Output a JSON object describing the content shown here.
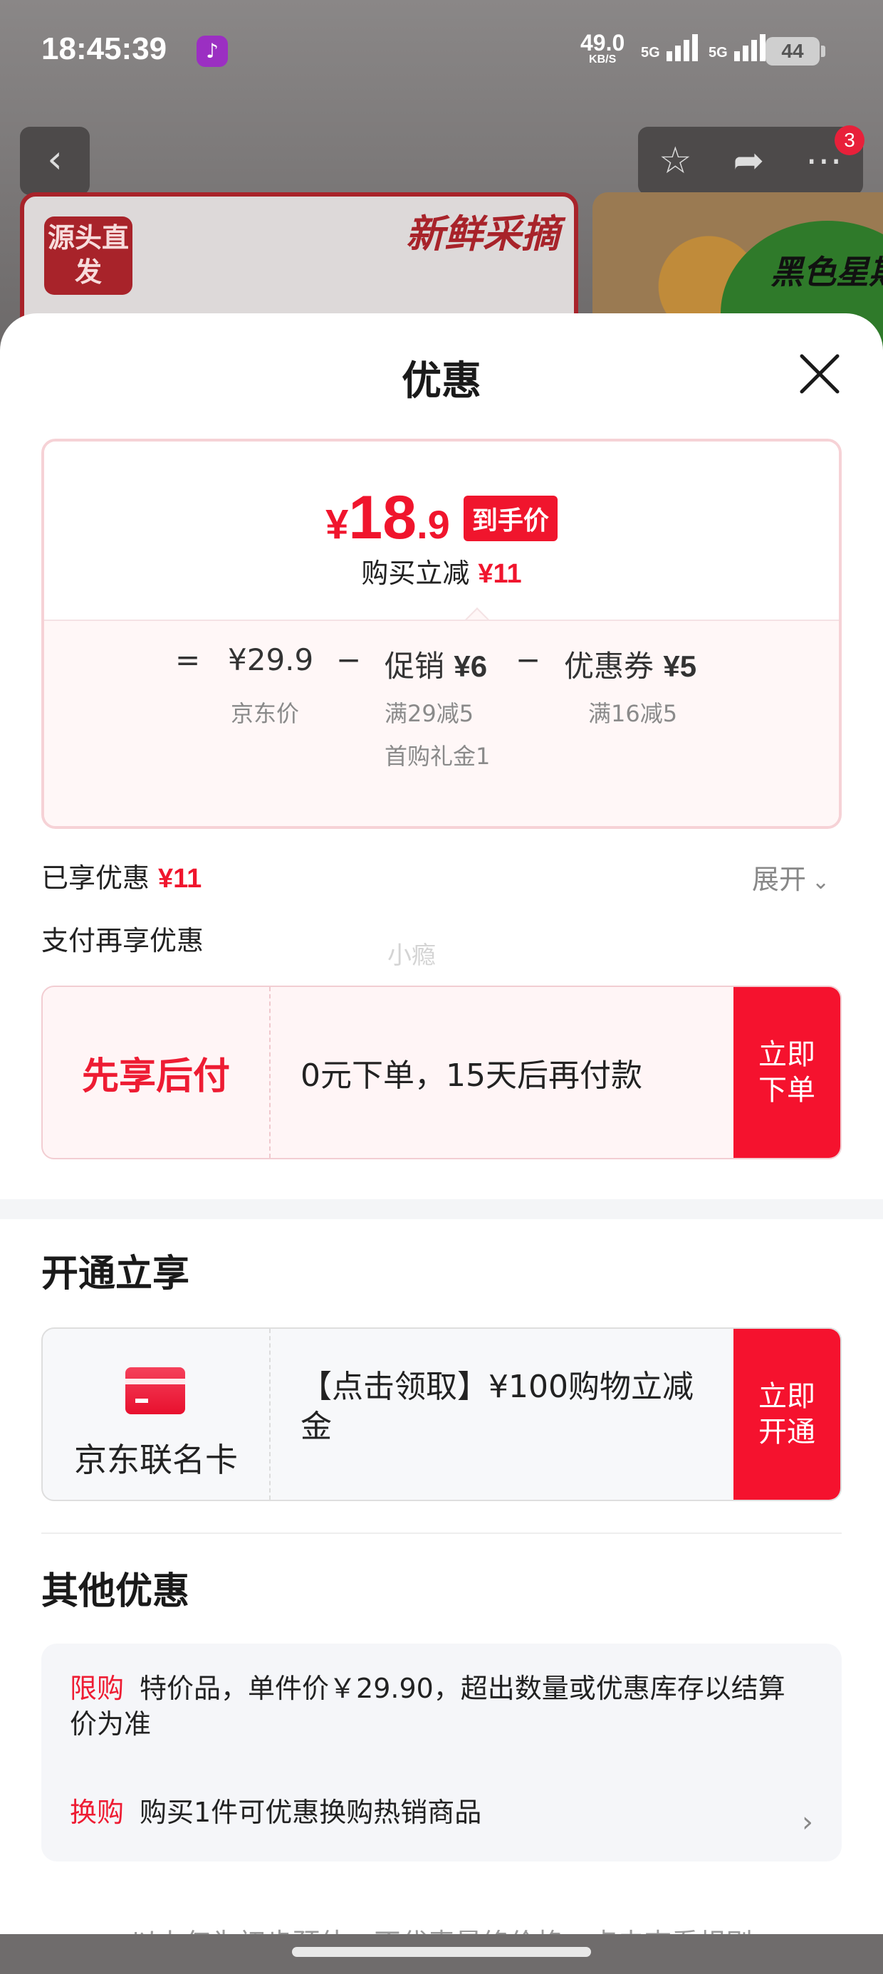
{
  "status_bar": {
    "time": "18:45:39",
    "speed_value": "49.0",
    "speed_unit": "KB/S",
    "network_1": "5G",
    "network_2": "5G",
    "battery": "44"
  },
  "background": {
    "nav_badge": "3",
    "banner_tag": "源头直发",
    "banner_slogan": "新鲜采摘",
    "side_banner_text": "黑色星期五"
  },
  "sheet": {
    "title": "优惠",
    "price_card": {
      "currency": "¥",
      "price_int": "18",
      "price_dec": ".9",
      "final_tag": "到手价",
      "instant_label": "购买立减",
      "instant_amount": "¥11",
      "equals": "=",
      "minus": "−",
      "jd_price": "¥29.9",
      "jd_label": "京东价",
      "promo_label": "促销",
      "promo_amount": "¥6",
      "promo_rule_1": "满29减5",
      "promo_rule_2": "首购礼金1",
      "coupon_label": "优惠券",
      "coupon_amount": "¥5",
      "coupon_rule": "满16减5"
    },
    "enjoyed_label": "已享优惠",
    "enjoyed_amount": "¥11",
    "expand_label": "展开",
    "pay_section_label": "支付再享优惠",
    "watermark": "小瘾",
    "pay_later": {
      "title": "先享后付",
      "desc": "0元下单，15天后再付款",
      "button": "立即下单"
    },
    "open_section_title": "开通立享",
    "co_card": {
      "title": "京东联名卡",
      "desc": "【点击领取】¥100购物立减金",
      "button": "立即开通"
    },
    "other_section_title": "其他优惠",
    "other_items": [
      {
        "kind": "限购",
        "text": "特价品，单件价￥29.90，超出数量或优惠库存以结算价为准"
      },
      {
        "kind": "换购",
        "text": "购买1件可优惠换购热销商品"
      }
    ],
    "disclaimer": "以上仅为初步预估，不代表最终价格，点击查看规则"
  },
  "icons": {
    "back": "chevron-left-icon",
    "favorite": "star-icon",
    "share": "share-icon",
    "more": "more-icon",
    "close": "close-icon",
    "expand": "chevron-down-icon",
    "card": "credit-card-icon",
    "arrow": "chevron-right-icon"
  },
  "colors": {
    "accent_red": "#F5122E",
    "price_red": "#F0152D",
    "muted_text": "#8A8A8A"
  }
}
